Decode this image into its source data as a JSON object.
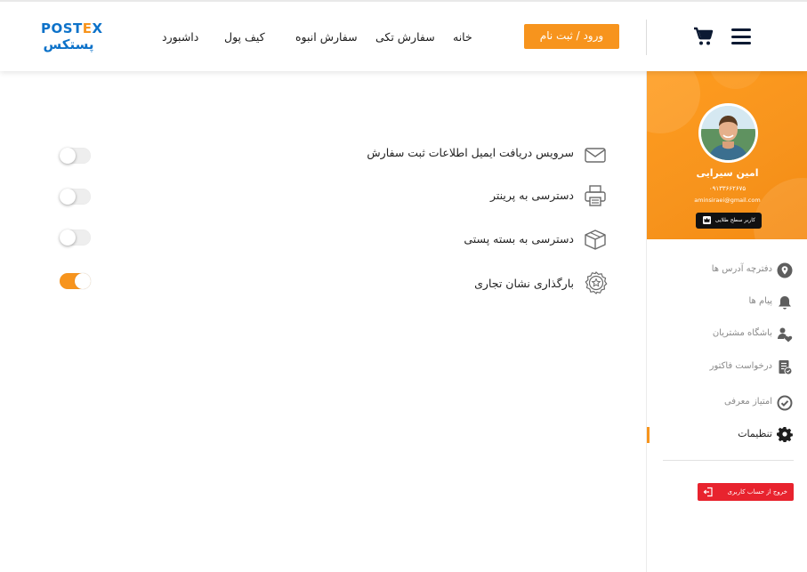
{
  "header": {
    "brand_latin_pre": "POST",
    "brand_latin_x": "E",
    "brand_latin_post": "X",
    "brand_farsi": "پستکس",
    "login_label": "ورود / ثبت نام",
    "nav": [
      "خانه",
      "سفارش تکی",
      "سفارش انبوه",
      "کیف پول",
      "داشبورد"
    ]
  },
  "settings": {
    "rows": [
      {
        "label": "سرویس دریافت ایمیل اطلاعات ثبت سفارش",
        "icon": "envelope-icon",
        "enabled": false
      },
      {
        "label": "دسترسی به پرینتر",
        "icon": "printer-icon",
        "enabled": false
      },
      {
        "label": "دسترسی به بسته پستی",
        "icon": "package-icon",
        "enabled": false
      },
      {
        "label": "بارگذاری نشان تجاری",
        "icon": "badge-star-icon",
        "enabled": true
      }
    ]
  },
  "profile": {
    "name": "امین سیرایی",
    "phone": "۰۹۱۳۳۶۶۲۶۷۵",
    "email": "aminsiraei@gmail.com",
    "level_label": "کاربر سطح طلایی"
  },
  "sidebar": {
    "items": [
      {
        "label": "دفترچه آدرس ها",
        "icon": "location-pin-icon"
      },
      {
        "label": "پیام ها",
        "icon": "bell-icon"
      },
      {
        "label": "باشگاه مشتریان",
        "icon": "customer-club-icon"
      },
      {
        "label": "درخواست فاکتور",
        "icon": "invoice-icon"
      },
      {
        "label": "امتیاز معرفی",
        "icon": "check-circle-icon"
      },
      {
        "label": "تنظیمات",
        "icon": "gear-icon",
        "active": true
      }
    ],
    "logout_label": "خروج از حساب کاربری"
  },
  "colors": {
    "accent": "#f7941d",
    "brand_blue": "#0d72c9",
    "danger": "#e8232e",
    "nav_dark": "#0c1a33"
  }
}
